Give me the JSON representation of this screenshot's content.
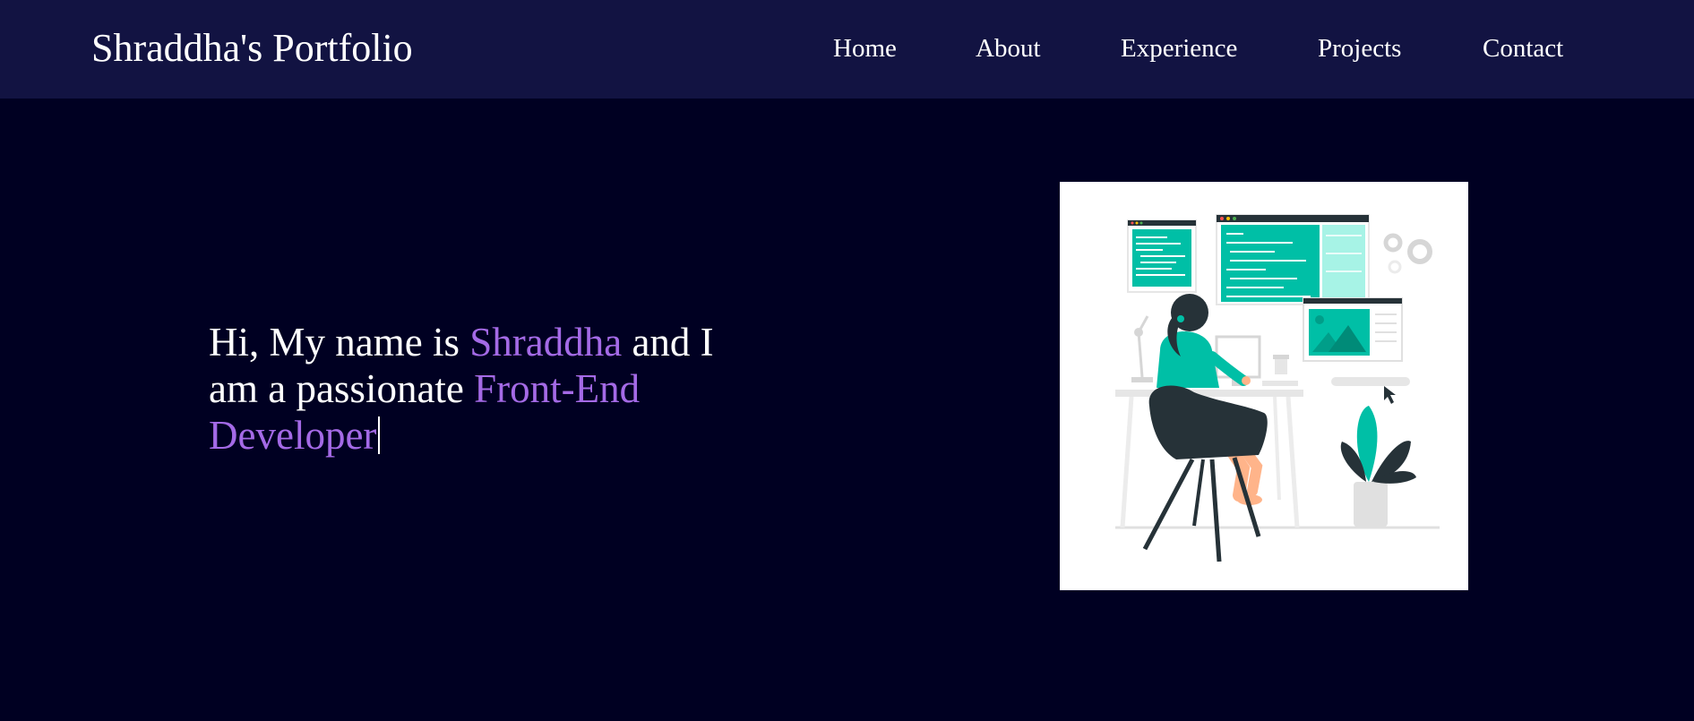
{
  "header": {
    "brand": "Shraddha's Portfolio",
    "nav": [
      {
        "label": "Home"
      },
      {
        "label": "About"
      },
      {
        "label": "Experience"
      },
      {
        "label": "Projects"
      },
      {
        "label": "Contact"
      }
    ]
  },
  "hero": {
    "line_part1": "Hi, My name is ",
    "name": "Shraddha",
    "line_part2": " and I am a passionate ",
    "role": "Front-End Developer",
    "illustration": "developer-working-at-desk-illustration"
  },
  "colors": {
    "page_bg": "#000022",
    "navbar_bg": "#121342",
    "accent": "#a46ae6",
    "illustration_teal": "#00bfa6"
  }
}
